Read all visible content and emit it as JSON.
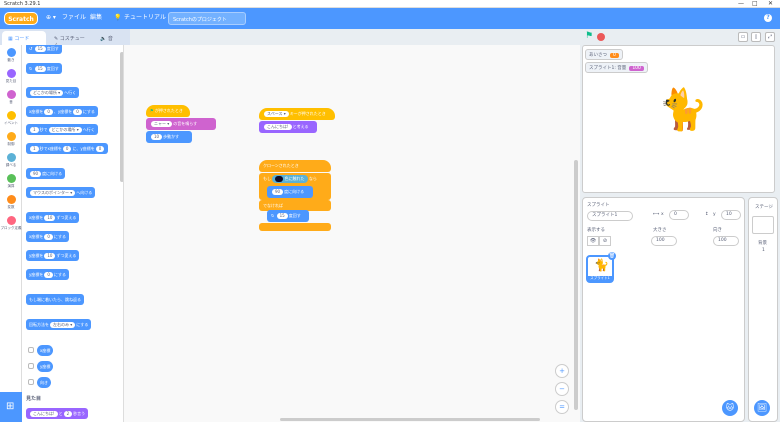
{
  "window": {
    "title": "Scratch 3.29.1",
    "controls": [
      "—",
      "□",
      "✕"
    ]
  },
  "menu": {
    "logo": "Scratch",
    "globe": "⊕ ▾",
    "file": "ファイル",
    "edit": "編集",
    "tutorial": "チュートリアル",
    "project_title": "Scratchのプロジェクト",
    "help": "?"
  },
  "tabs": {
    "code": "コード",
    "costume": "コスチューム",
    "sound": "音"
  },
  "categories": [
    {
      "label": "動き",
      "color": "#4c97ff"
    },
    {
      "label": "見た目",
      "color": "#9966ff"
    },
    {
      "label": "音",
      "color": "#cf63cf"
    },
    {
      "label": "イベント",
      "color": "#ffbf00"
    },
    {
      "label": "制御",
      "color": "#ffab19"
    },
    {
      "label": "調べる",
      "color": "#5cb1d6"
    },
    {
      "label": "演算",
      "color": "#59c059"
    },
    {
      "label": "変数",
      "color": "#ff8c1a"
    },
    {
      "label": "ブロック定義",
      "color": "#ff6680"
    }
  ],
  "palette": {
    "b1": {
      "pre": "",
      "val": "15",
      "post": "度回す"
    },
    "b2": {
      "pre": "",
      "val": "15",
      "post": "度回す"
    },
    "b3": {
      "pre": "どこかの場所 ▾",
      "post": "へ行く"
    },
    "b4": {
      "a": "x座標を",
      "v1": "0",
      "m": "、y座標を",
      "v2": "0",
      "post": "にする"
    },
    "b5": {
      "v": "1",
      "t": "秒で",
      "o": "どこかの場所 ▾",
      "post": "へ行く"
    },
    "b6": {
      "v": "1",
      "t": "秒でx座標を",
      "v2": "0",
      "t2": "に、y座標を",
      "v3": "0"
    },
    "b7": {
      "v": "90",
      "post": "度に向ける"
    },
    "b8": {
      "o": "マウスのポインター ▾",
      "post": "へ向ける"
    },
    "b9": {
      "pre": "x座標を",
      "v": "10",
      "post": "ずつ変える"
    },
    "b10": {
      "pre": "x座標を",
      "v": "0",
      "post": "にする"
    },
    "b11": {
      "pre": "y座標を",
      "v": "10",
      "post": "ずつ変える"
    },
    "b12": {
      "pre": "y座標を",
      "v": "0",
      "post": "にする"
    },
    "b13": {
      "text": "もし端に着いたら、跳ね返る"
    },
    "b14": {
      "pre": "回転方法を",
      "o": "左右のみ ▾",
      "post": "にする"
    },
    "r1": "x座標",
    "r2": "y座標",
    "r3": "向き",
    "looks_header": "見た目",
    "b15": {
      "v": "こんにちは!",
      "m": "と",
      "v2": "2",
      "post": "秒言う"
    }
  },
  "scripts": {
    "s1": {
      "hat": "が押されたとき",
      "b1": {
        "o": "ニャー ▾",
        "post": "の音を鳴らす"
      },
      "b2": {
        "v": "10",
        "post": "歩動かす"
      }
    },
    "s2": {
      "hat": {
        "o": "スペース ▾",
        "post": "キーが押されたとき"
      },
      "b1": {
        "v": "こんにちは!",
        "post": "と考える"
      }
    },
    "s3": {
      "hat": "クローンされたとき",
      "if_label": "もし",
      "touching": "色に触れた",
      "then": "なら",
      "b1": {
        "v": "90",
        "post": "度に向ける"
      },
      "else_label": "でなければ",
      "b2": {
        "v": "15",
        "post": "度回す"
      }
    }
  },
  "zoom": {
    "in": "+",
    "out": "−",
    "reset": "="
  },
  "stage": {
    "monitor1": {
      "label": "あいさつ",
      "value": "0"
    },
    "monitor2": {
      "label": "スプライト1: 音量",
      "value": "100"
    }
  },
  "sprite_panel": {
    "sprite_label": "スプライト",
    "sprite_name": "スプライト1",
    "x_label": "x",
    "x_value": "0",
    "y_label": "y",
    "y_value": "10",
    "show_label": "表示する",
    "size_label": "大きさ",
    "size_value": "100",
    "direction_label": "向き",
    "direction_value": "100",
    "thumb_name": "スプライト1"
  },
  "stage_panel": {
    "label": "ステージ",
    "backdrop_label": "背景",
    "backdrop_count": "1"
  },
  "colors": {
    "motion": "#4c97ff",
    "looks": "#9966ff",
    "sound": "#cf63cf",
    "events": "#ffbf00",
    "control": "#ffab19",
    "sensing": "#5cb1d6"
  }
}
